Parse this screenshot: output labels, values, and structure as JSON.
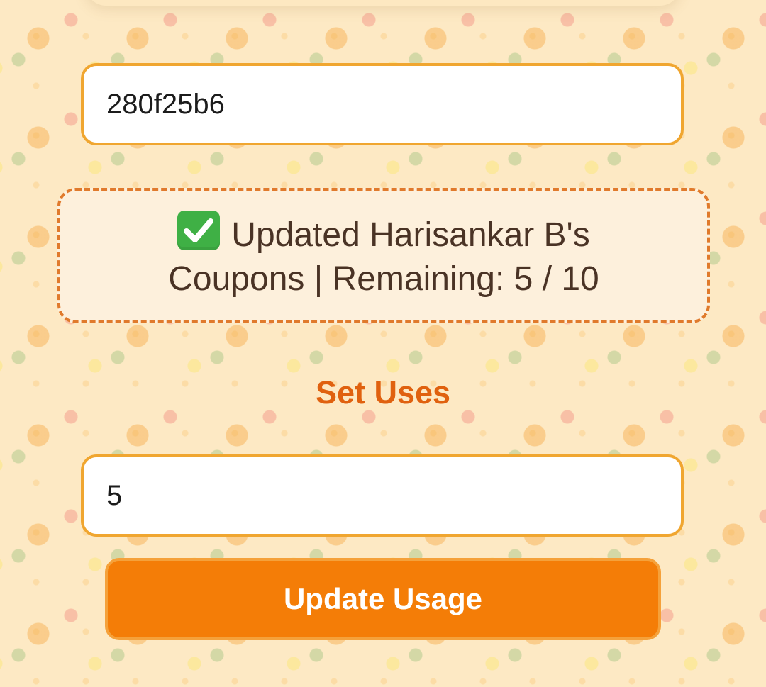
{
  "form": {
    "code_value": "280f25b6",
    "status_message": "Updated Harisankar B's Coupons | Remaining: 5 / 10",
    "status_icon": "check-mark-icon",
    "section_title": "Set Uses",
    "uses_value": "5",
    "update_button_label": "Update Usage"
  },
  "colors": {
    "accent": "#f47d07",
    "border": "#f0a630",
    "title": "#e0610f",
    "status_border": "#e07a2c",
    "success": "#3fb045"
  }
}
